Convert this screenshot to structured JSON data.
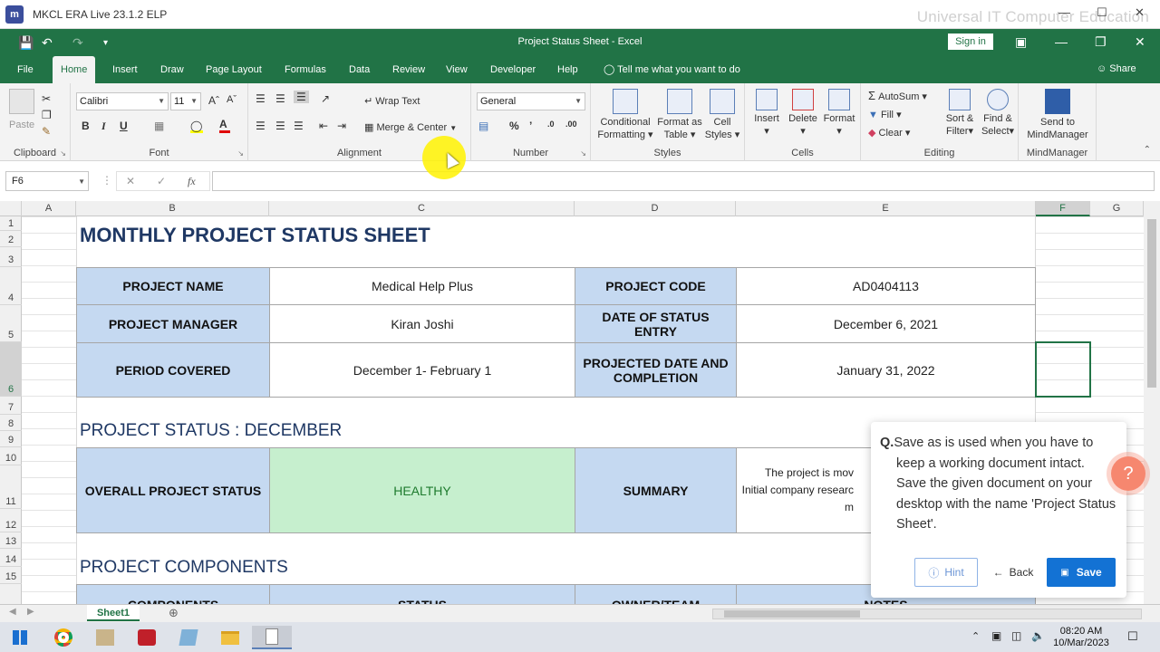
{
  "app": {
    "title": "MKCL ERA Live 23.1.2 ELP",
    "watermark": "Universal IT Computer Education"
  },
  "excel": {
    "doc_title": "Project Status Sheet  -  Excel",
    "sign_in": "Sign in",
    "tabs": [
      "File",
      "Home",
      "Insert",
      "Draw",
      "Page Layout",
      "Formulas",
      "Data",
      "Review",
      "View",
      "Developer",
      "Help"
    ],
    "active_tab": "Home",
    "tell_me": "Tell me what you want to do",
    "share": "Share"
  },
  "ribbon": {
    "clipboard": {
      "label": "Clipboard",
      "paste": "Paste"
    },
    "font": {
      "label": "Font",
      "name": "Calibri",
      "size": "11",
      "bold": "B",
      "italic": "I",
      "underline": "U"
    },
    "alignment": {
      "label": "Alignment",
      "wrap": "Wrap Text",
      "merge": "Merge & Center"
    },
    "number": {
      "label": "Number",
      "format": "General"
    },
    "styles": {
      "label": "Styles",
      "conditional": [
        "Conditional",
        "Formatting"
      ],
      "format_table": [
        "Format as",
        "Table"
      ],
      "cell_styles": [
        "Cell",
        "Styles"
      ]
    },
    "cells": {
      "label": "Cells",
      "insert": "Insert",
      "delete": "Delete",
      "format": "Format"
    },
    "editing": {
      "label": "Editing",
      "autosum": "AutoSum",
      "fill": "Fill",
      "clear": "Clear",
      "sort": [
        "Sort &",
        "Filter"
      ],
      "find": [
        "Find &",
        "Select"
      ]
    },
    "mindmanager": {
      "label": "MindManager",
      "send": [
        "Send to",
        "MindManager"
      ]
    }
  },
  "formula_bar": {
    "name_box": "F6",
    "fx": "fx",
    "value": ""
  },
  "grid": {
    "columns": [
      "A",
      "B",
      "C",
      "D",
      "E",
      "F",
      "G"
    ],
    "selected_column": "F",
    "rows": [
      "1",
      "2",
      "3",
      "4",
      "5",
      "6",
      "7",
      "8",
      "9",
      "10",
      "11",
      "12",
      "13",
      "14",
      "15"
    ],
    "selected_row": "6"
  },
  "sheet": {
    "title": "MONTHLY PROJECT STATUS SHEET",
    "project_name_label": "PROJECT NAME",
    "project_name": "Medical Help Plus",
    "project_code_label": "PROJECT CODE",
    "project_code": "AD0404113",
    "manager_label": "PROJECT MANAGER",
    "manager": "Kiran Joshi",
    "status_date_label": "DATE OF STATUS ENTRY",
    "status_date": "December 6, 2021",
    "period_label": "PERIOD COVERED",
    "period": "December 1- February 1",
    "projected_label": "PROJECTED DATE AND COMPLETION",
    "projected": "January 31, 2022",
    "status_heading": "PROJECT STATUS : DECEMBER",
    "overall_label": "OVERALL PROJECT STATUS",
    "overall": "HEALTHY",
    "summary_label": "SUMMARY",
    "summary_lines": [
      "The project is mov",
      "Initial company researc",
      "m"
    ],
    "components_heading": "PROJECT COMPONENTS",
    "comp_headers": [
      "COMPONENTS",
      "STATUS",
      "OWNER/TEAM",
      "NOTES"
    ]
  },
  "sheet_tab": "Sheet1",
  "question": {
    "prefix": "Q.",
    "text": "Save as is used when you have to keep a working document intact. Save the given document on your desktop with the name 'Project Status Sheet'.",
    "hint": "Hint",
    "back": "Back",
    "save": "Save"
  },
  "taskbar": {
    "time": "08:20 AM",
    "date": "10/Mar/2023"
  },
  "colors": {
    "excel_green": "#217346",
    "label_blue": "#c5d9f1",
    "healthy_green": "#c6efce",
    "healthy_text": "#1e7b2e",
    "save_blue": "#1372d4"
  }
}
